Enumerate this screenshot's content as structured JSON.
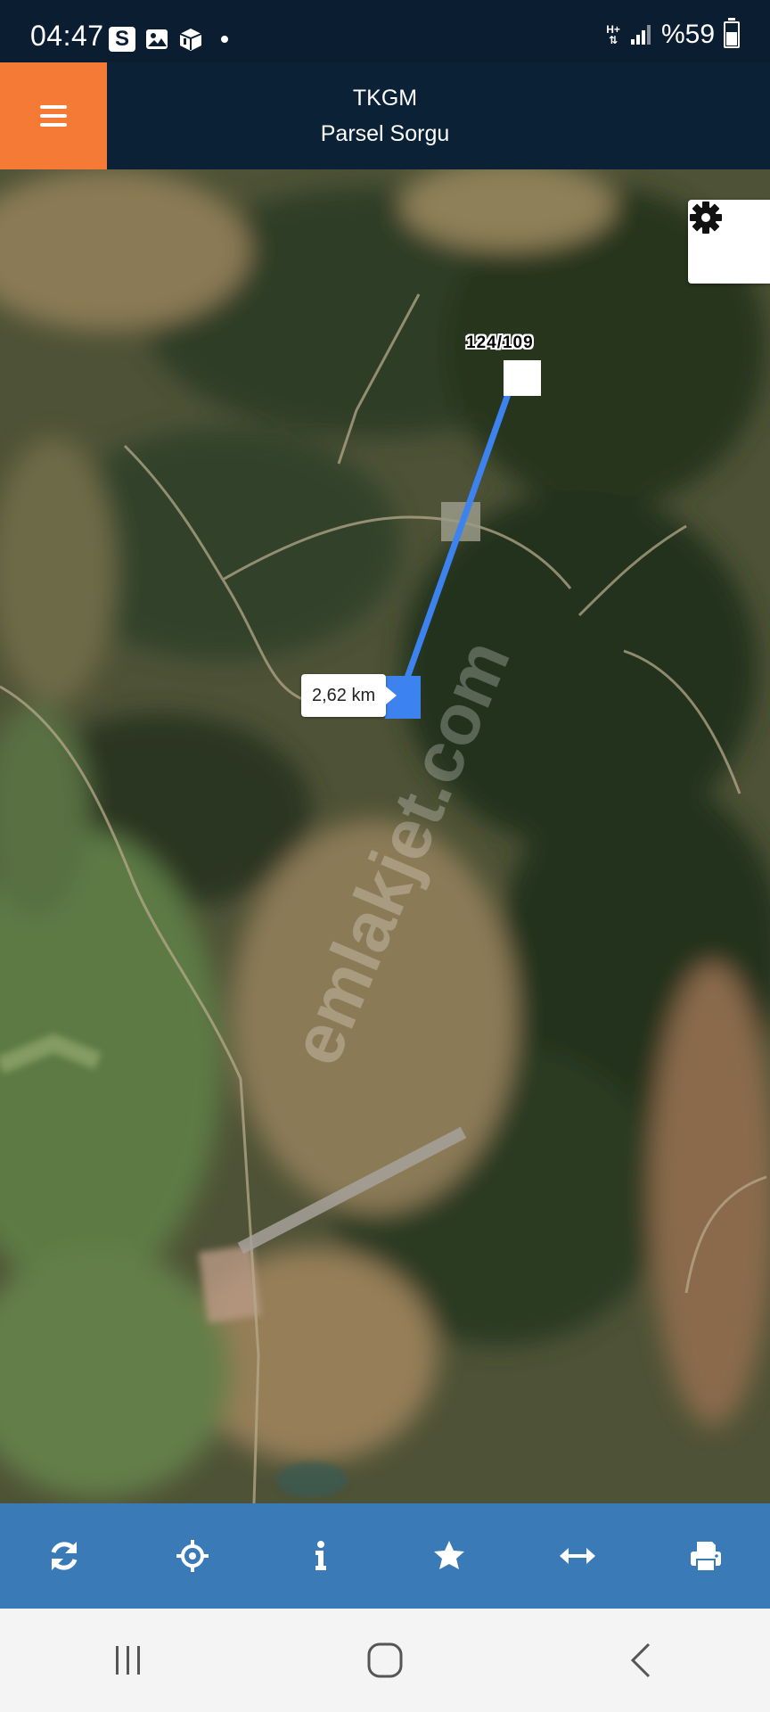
{
  "status_bar": {
    "time": "04:47",
    "notification_badge": "S",
    "network": "H+",
    "battery": "%59",
    "battery_level": 0.59
  },
  "app_bar": {
    "title_line1": "TKGM",
    "title_line2": "Parsel Sorgu"
  },
  "map": {
    "parcel_label": "124/109",
    "distance_label": "2,62 km",
    "watermark": "emlakjet.com",
    "measure_line_color": "#3d83f0"
  },
  "toolbar": {
    "items": [
      "refresh-icon",
      "crosshair-icon",
      "info-icon",
      "star-icon",
      "measure-icon",
      "print-icon"
    ]
  },
  "colors": {
    "menu_orange": "#f47a35",
    "app_bar_bg": "#0b2136",
    "toolbar_blue": "#3a7ab7"
  }
}
